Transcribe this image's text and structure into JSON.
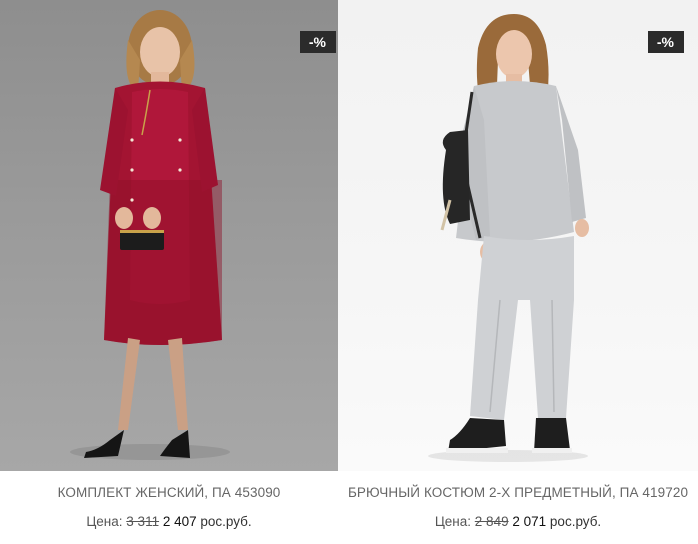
{
  "products": [
    {
      "name": "КОМПЛЕКТ ЖЕНСКИЙ, ПА 453090",
      "price_label": "Цена:",
      "old_price": "3 311",
      "new_price": "2 407",
      "currency": "рос.руб.",
      "badge": "-%"
    },
    {
      "name": "БРЮЧНЫЙ КОСТЮМ 2-Х ПРЕДМЕТНЫЙ, ПА 419720",
      "price_label": "Цена:",
      "old_price": "2 849",
      "new_price": "2 071",
      "currency": "рос.руб.",
      "badge": "-%"
    }
  ]
}
